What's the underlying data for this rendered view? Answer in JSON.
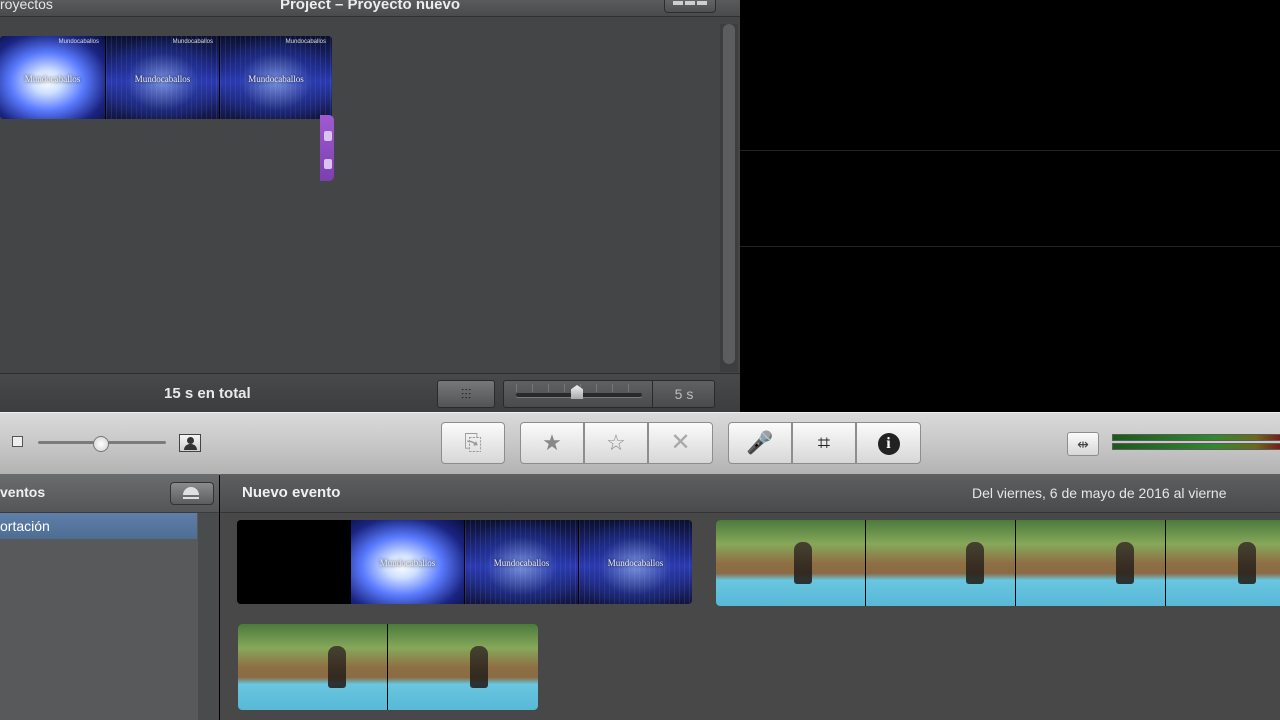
{
  "project": {
    "projects_tab_label": "royectos",
    "title": "Project – Proyecto nuevo",
    "total_duration": "15 s en total",
    "zoom_value": "5 s",
    "clips": [
      {
        "label": "Mundocaballos",
        "logo": "Mundocaballos"
      },
      {
        "label": "Mundocaballos",
        "logo": "Mundocaballos"
      },
      {
        "label": "Mundocaballos",
        "logo": "Mundocaballos"
      }
    ]
  },
  "toolbar": {
    "thumbnail_size_level": 0.49,
    "buttons": [
      {
        "name": "add-to-project",
        "icon": "add-to-project-icon",
        "glyph": "⎘"
      },
      {
        "name": "mark-favorite",
        "icon": "star-filled-icon",
        "glyph": "★"
      },
      {
        "name": "unmark",
        "icon": "star-outline-icon",
        "glyph": "☆"
      },
      {
        "name": "reject",
        "icon": "x-icon",
        "glyph": "✕"
      },
      {
        "name": "voiceover",
        "icon": "microphone-icon",
        "glyph": "🎤"
      },
      {
        "name": "crop",
        "icon": "crop-icon",
        "glyph": "⌗"
      },
      {
        "name": "info",
        "icon": "info-icon",
        "glyph": "i"
      }
    ],
    "audio_adjust_glyph": "⇹"
  },
  "event_library": {
    "header": "ventos",
    "items": [
      {
        "label": "ortación",
        "selected": true
      }
    ]
  },
  "event_browser": {
    "event_name": "Nuevo evento",
    "date_range": "Del viernes, 6 de mayo de 2016 al vierne",
    "clip1_label": "Mundocaballos"
  },
  "colors": {
    "accent_selection": "#5f7fa8",
    "marker_purple": "#8a4bc0"
  }
}
